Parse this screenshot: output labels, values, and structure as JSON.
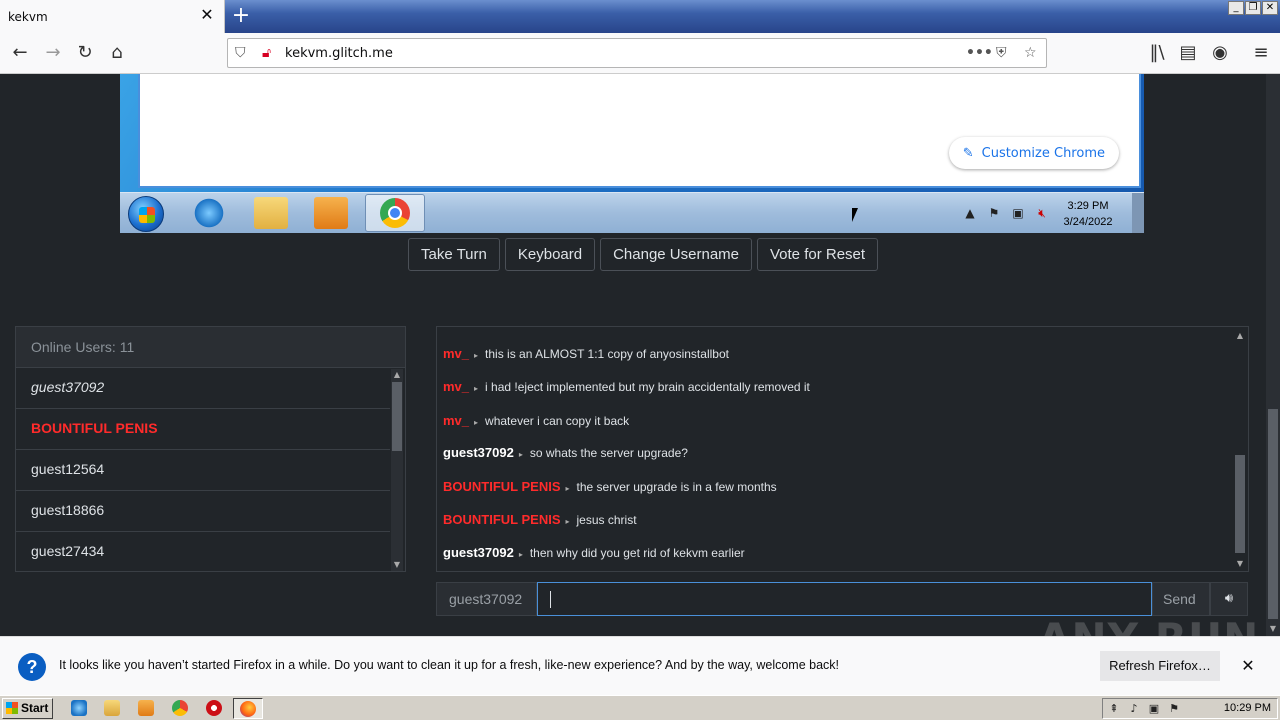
{
  "browser": {
    "tab_title": "kekvm",
    "tab_close": "✕",
    "new_tab": "+",
    "url": "kekvm.glitch.me",
    "url_more": "•••"
  },
  "vm": {
    "customize_label": "Customize Chrome",
    "clock_time": "3:29 PM",
    "clock_date": "3/24/2022"
  },
  "controls": {
    "take_turn": "Take Turn",
    "keyboard": "Keyboard",
    "change_username": "Change Username",
    "vote_reset": "Vote for Reset"
  },
  "users": {
    "header": "Online Users: 11",
    "list": [
      {
        "name": "guest37092"
      },
      {
        "name": "BOUNTIFUL PENIS"
      },
      {
        "name": "guest12564"
      },
      {
        "name": "guest18866"
      },
      {
        "name": "guest27434"
      }
    ]
  },
  "chat": {
    "messages": [
      {
        "user": "mv_",
        "text": "this is an ALMOST 1:1 copy of anyosinstallbot"
      },
      {
        "user": "mv_",
        "text": "i had !eject implemented but my brain accidentally removed it"
      },
      {
        "user": "mv_",
        "text": "whatever i can copy it back"
      },
      {
        "user": "guest37092",
        "text": "so whats the server upgrade?"
      },
      {
        "user": "BOUNTIFUL PENIS",
        "text": "the server upgrade is in a few months"
      },
      {
        "user": "BOUNTIFUL PENIS",
        "text": "jesus christ"
      },
      {
        "user": "guest37092",
        "text": "then why did you get rid of kekvm earlier"
      }
    ],
    "arrow": "▸",
    "input_username": "guest37092",
    "input_value": "",
    "send_label": "Send"
  },
  "notification": {
    "text": "It looks like you haven’t started Firefox in a while. Do you want to clean it up for a fresh, like-new experience? And by the way, welcome back!",
    "button": "Refresh Firefox…",
    "close": "✕",
    "icon": "?"
  },
  "taskbar": {
    "start_label": "Start",
    "time": "10:29 PM"
  },
  "watermark": "ANY RUN",
  "colors": {
    "user_red": "#ff2b2b",
    "page_bg": "#212529",
    "input_focus": "#4a90d9"
  }
}
